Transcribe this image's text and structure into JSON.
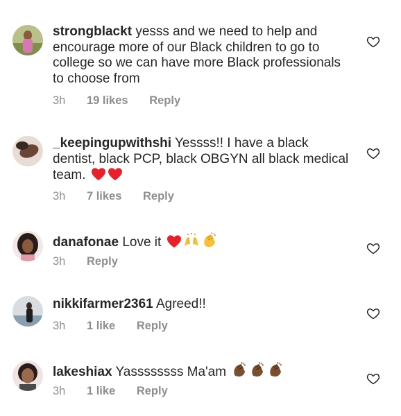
{
  "comments": [
    {
      "username": "strongblackt",
      "text": "yesss and we need to help and encourage more of our Black children to go to college so we can have more Black professionals to choose from",
      "time": "3h",
      "likes": "19 likes",
      "reply": "Reply",
      "emojis": []
    },
    {
      "username": "_keepingupwithshi",
      "text": "Yessss!! I have a black dentist, black PCP, black OBGYN all black medical team.",
      "time": "3h",
      "likes": "7 likes",
      "reply": "Reply",
      "emojis": [
        "red-heart",
        "red-heart"
      ]
    },
    {
      "username": "danafonae",
      "text": "Love it",
      "time": "3h",
      "likes": "",
      "reply": "Reply",
      "emojis": [
        "red-heart",
        "raising-hands",
        "clapping-hands"
      ]
    },
    {
      "username": "nikkifarmer2361",
      "text": "Agreed!!",
      "time": "3h",
      "likes": "1 like",
      "reply": "Reply",
      "emojis": []
    },
    {
      "username": "lakeshiax",
      "text": "Yassssssss Ma'am",
      "time": "3h",
      "likes": "1 like",
      "reply": "Reply",
      "emojis": [
        "clapping-hands-dark",
        "clapping-hands-dark",
        "clapping-hands-dark"
      ]
    }
  ],
  "icons": {
    "like": "heart-outline-icon"
  },
  "colors": {
    "text": "#262626",
    "meta": "#8e8e8e",
    "heart": "#e8202c"
  }
}
